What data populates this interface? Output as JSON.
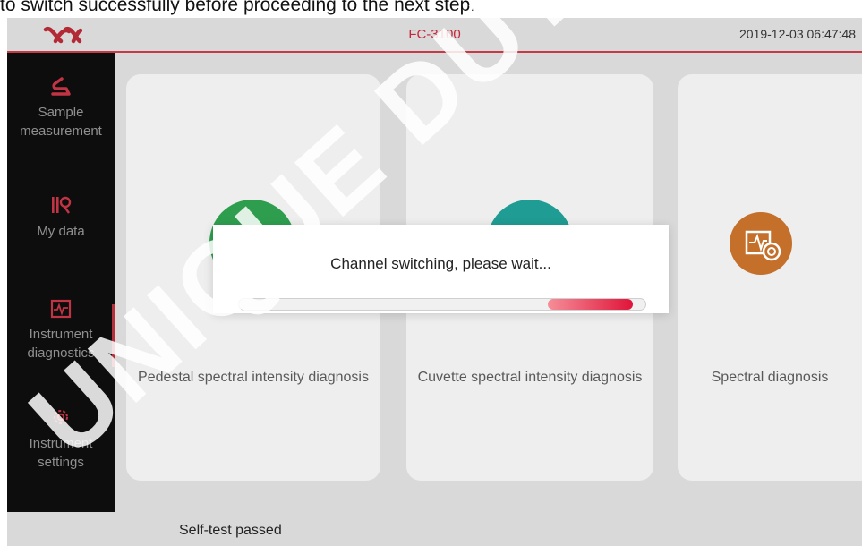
{
  "caption": "to switch successfully before proceeding to the next step.",
  "header": {
    "title": "FC-3100",
    "datetime": "2019-12-03 06:47:48",
    "logo_icon": "alpha-logo-icon"
  },
  "sidebar": {
    "items": [
      {
        "label": "Sample measurement",
        "icon": "pedestal-icon"
      },
      {
        "label": "My data",
        "icon": "data-icon"
      },
      {
        "label": "Instrument diagnostics",
        "icon": "waveform-icon",
        "active": true
      },
      {
        "label": "Instrument settings",
        "icon": "gear-icon"
      }
    ]
  },
  "cards": [
    {
      "label": "Pedestal spectral intensity diagnosis",
      "icon_color": "#2e9e4e"
    },
    {
      "label": "Cuvette spectral intensity diagnosis",
      "icon_color": "#1f9c93"
    },
    {
      "label": "Spectral diagnosis",
      "icon_color": "#c46f2a",
      "icon": "spectral-diagnosis-icon"
    }
  ],
  "status": {
    "text": "Self-test passed"
  },
  "dialog": {
    "message": "Channel switching, please wait...",
    "progress_segment": [
      0.76,
      0.97
    ]
  },
  "watermark": {
    "text": "UNIQUE DUTCH"
  },
  "colors": {
    "accent": "#c6283a",
    "sidebar_bg": "#0d0d0d",
    "overlay": "#d9d9d9"
  }
}
